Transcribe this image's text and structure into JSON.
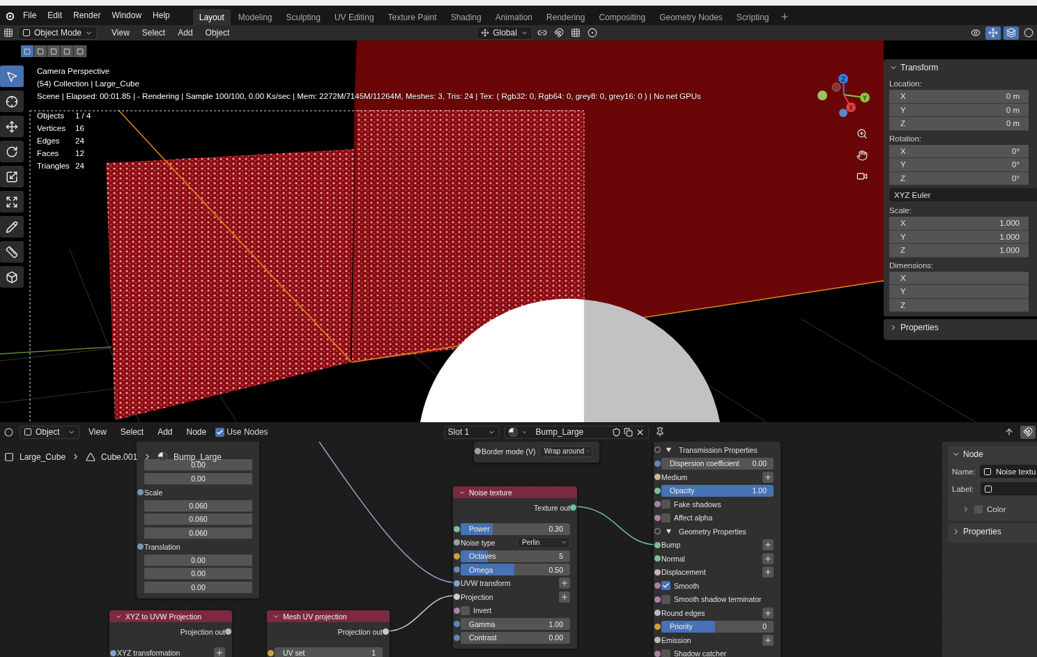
{
  "menu": [
    "File",
    "Edit",
    "Render",
    "Window",
    "Help"
  ],
  "workspaces": [
    {
      "label": "Layout",
      "selected": true
    },
    {
      "label": "Modeling",
      "selected": false
    },
    {
      "label": "Sculpting",
      "selected": false
    },
    {
      "label": "UV Editing",
      "selected": false
    },
    {
      "label": "Texture Paint",
      "selected": false
    },
    {
      "label": "Shading",
      "selected": false
    },
    {
      "label": "Animation",
      "selected": false
    },
    {
      "label": "Rendering",
      "selected": false
    },
    {
      "label": "Compositing",
      "selected": false
    },
    {
      "label": "Geometry Nodes",
      "selected": false
    },
    {
      "label": "Scripting",
      "selected": false
    }
  ],
  "viewport_header": {
    "mode": "Object Mode",
    "menus": [
      "View",
      "Select",
      "Add",
      "Object"
    ],
    "orientation": "Global"
  },
  "select_modes": [
    {
      "selected": true
    },
    {
      "selected": false
    },
    {
      "selected": false
    },
    {
      "selected": false
    },
    {
      "selected": false
    }
  ],
  "tools": [
    {
      "kind": "select",
      "selected": true
    },
    {
      "kind": "cursor",
      "selected": false
    },
    {
      "kind": "move",
      "selected": false
    },
    {
      "kind": "rotate",
      "selected": false
    },
    {
      "kind": "scale",
      "selected": false
    },
    {
      "kind": "transform",
      "selected": false
    },
    {
      "kind": "annotate",
      "selected": false
    },
    {
      "kind": "measure",
      "selected": false
    },
    {
      "kind": "add-cube",
      "selected": false
    }
  ],
  "overlay": {
    "lines": [
      "Camera Perspective",
      "(54) Collection | Large_Cube",
      "Scene | Elapsed: 00:01.85 |  - Rendering | Sample 100/100, 0.00 Ks/sec | Mem: 2272M/7145M/11264M, Meshes: 3, Tris: 24 | Tex: ( Rgb32: 0, Rgb64: 0, grey8: 0, grey16: 0 ) | No net GPUs"
    ],
    "stats": [
      {
        "label": "Objects",
        "value": "1 / 4"
      },
      {
        "label": "Vertices",
        "value": "16"
      },
      {
        "label": "Edges",
        "value": "24"
      },
      {
        "label": "Faces",
        "value": "12"
      },
      {
        "label": "Triangles",
        "value": "24"
      }
    ]
  },
  "gizmo": {
    "axes": [
      {
        "label": "Z",
        "color": "#2f83e3"
      },
      {
        "label": "Y",
        "color": "#8bc53f"
      },
      {
        "label": "X",
        "color": "#e2413f"
      }
    ]
  },
  "sidebar": {
    "panels": [
      {
        "title": "Transform",
        "expanded": true,
        "groups": [
          {
            "label": "Location:",
            "fields": [
              {
                "axis": "X",
                "value": "0 m"
              },
              {
                "axis": "Y",
                "value": "0 m"
              },
              {
                "axis": "Z",
                "value": "0 m"
              }
            ]
          },
          {
            "label": "Rotation:",
            "fields": [
              {
                "axis": "X",
                "value": "0°"
              },
              {
                "axis": "Y",
                "value": "0°"
              },
              {
                "axis": "Z",
                "value": "0°"
              }
            ],
            "mode": "XYZ Euler"
          },
          {
            "label": "Scale:",
            "fields": [
              {
                "axis": "X",
                "value": "1.000"
              },
              {
                "axis": "Y",
                "value": "1.000"
              },
              {
                "axis": "Z",
                "value": "1.000"
              }
            ]
          },
          {
            "label": "Dimensions:",
            "fields": [
              {
                "axis": "X"
              },
              {
                "axis": "Y"
              },
              {
                "axis": "Z"
              }
            ]
          }
        ]
      },
      {
        "title": "Properties",
        "expanded": false
      }
    ]
  },
  "node_editor": {
    "header": {
      "editor": "Object",
      "menus": [
        "View",
        "Select",
        "Add",
        "Node"
      ],
      "use_nodes": {
        "label": "Use Nodes",
        "checked": true
      },
      "slot": "Slot 1",
      "material": "Bump_Large"
    },
    "breadcrumbs": [
      {
        "kind": "object",
        "label": "Large_Cube"
      },
      {
        "kind": "mesh",
        "label": "Cube.001"
      },
      {
        "kind": "material",
        "label": "Bump_Large"
      }
    ],
    "nodes": [
      {
        "rows": [
          {
            "kind": "field",
            "value": "0.00"
          },
          {
            "kind": "field",
            "value": "0.00"
          },
          {
            "kind": "label",
            "label": "Scale",
            "color": "#7393c2"
          },
          {
            "kind": "field",
            "value": "0.060"
          },
          {
            "kind": "field",
            "value": "0.060"
          },
          {
            "kind": "field",
            "value": "0.060"
          },
          {
            "kind": "label",
            "label": "Translation",
            "color": "#7393c2"
          },
          {
            "kind": "field",
            "value": "0.00"
          },
          {
            "kind": "field",
            "value": "0.00"
          },
          {
            "kind": "field",
            "value": "0.00"
          }
        ]
      },
      {
        "title": "XYZ to UVW Projection",
        "rows": [
          {
            "kind": "output",
            "label": "Projection out",
            "color": "#b8b8b8"
          },
          {
            "kind": "link",
            "label": "XYZ transformation",
            "color": "#7fa3cc"
          }
        ]
      },
      {
        "title": "Mesh UV projection",
        "rows": [
          {
            "kind": "output",
            "label": "Projection out",
            "color": "#c8c8c8"
          },
          {
            "kind": "number",
            "label": "UV set",
            "value": "1",
            "color": "#c9a531"
          }
        ]
      },
      {
        "rows": [
          {
            "kind": "select",
            "label": "Border mode (V)",
            "value": "Wrap around",
            "color": "#a0a0a0"
          }
        ]
      },
      {
        "title": "Noise texture",
        "rows": [
          {
            "kind": "output",
            "label": "Texture out",
            "color": "#6ec29d"
          },
          {
            "kind": "slider",
            "label": "Power",
            "value": "0.30",
            "level": 0.29,
            "color": "#7bbf9a"
          },
          {
            "kind": "select",
            "label": "Noise type",
            "value": "Perlin",
            "color": "#a0a0a0"
          },
          {
            "kind": "slider",
            "label": "Octaves",
            "value": "5",
            "level": 0.25,
            "color": "#c9a531"
          },
          {
            "kind": "slider",
            "label": "Omega",
            "value": "0.50",
            "level": 0.49,
            "color": "#6388b6"
          },
          {
            "kind": "link",
            "label": "UVW transform",
            "color": "#7fa3cc"
          },
          {
            "kind": "link",
            "label": "Projection",
            "color": "#cccccc"
          },
          {
            "kind": "check",
            "label": "Invert",
            "checked": false,
            "color": "#ad7fa6"
          },
          {
            "kind": "number",
            "label": "Gamma",
            "value": "1.00",
            "color": "#5f87b8"
          },
          {
            "kind": "number",
            "label": "Contrast",
            "value": "0.00",
            "color": "#5f87b8"
          }
        ]
      },
      {
        "rows": [
          {
            "kind": "section",
            "label": "Transmission Properties",
            "expanded": true
          },
          {
            "kind": "number",
            "label": "Dispersion coefficient",
            "value": "0.00",
            "color": "#6289b9"
          },
          {
            "kind": "link",
            "label": "Medium",
            "color": "#c9b98d"
          },
          {
            "kind": "slider",
            "label": "Opacity",
            "value": "1.00",
            "level": 1,
            "color": "#7bbf9a"
          },
          {
            "kind": "check",
            "label": "Fake shadows",
            "checked": false,
            "color": "#ad7fa6"
          },
          {
            "kind": "check",
            "label": "Affect alpha",
            "checked": false,
            "color": "#ad7fa6"
          },
          {
            "kind": "section",
            "label": "Geometry Properties",
            "expanded": true
          },
          {
            "kind": "link",
            "label": "Bump",
            "color": "#7bbf9a"
          },
          {
            "kind": "link",
            "label": "Normal",
            "color": "#7bbf9a"
          },
          {
            "kind": "link",
            "label": "Displacement",
            "color": "#b8b8b8"
          },
          {
            "kind": "check",
            "label": "Smooth",
            "checked": true,
            "color": "#ad7fa6"
          },
          {
            "kind": "check",
            "label": "Smooth shadow terminator",
            "checked": false,
            "color": "#ad7fa6"
          },
          {
            "kind": "link",
            "label": "Round edges",
            "color": "#b8b8b8"
          },
          {
            "kind": "slider",
            "label": "Priority",
            "value": "0",
            "level": 0.48,
            "color": "#c9a531"
          },
          {
            "kind": "link",
            "label": "Emission",
            "color": "#b8b8b8"
          },
          {
            "kind": "check",
            "label": "Shadow catcher",
            "checked": false,
            "color": "#ad7fa6"
          }
        ]
      }
    ],
    "sidebar": {
      "panels": [
        {
          "title": "Node",
          "expanded": true,
          "name_label": "Name:",
          "name_value": "Noise textu",
          "label_label": "Label:",
          "color": {
            "label": "Color",
            "expanded": false
          }
        },
        {
          "title": "Properties",
          "expanded": false
        }
      ]
    }
  }
}
